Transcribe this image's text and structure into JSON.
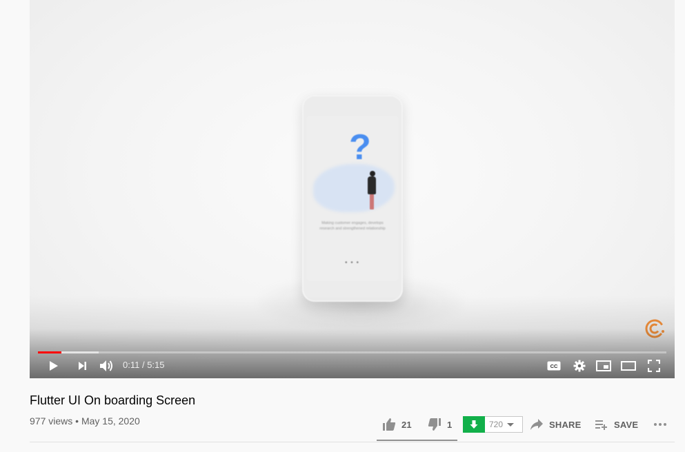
{
  "player": {
    "current_time": "0:11",
    "separator": " / ",
    "duration": "5:15",
    "played_fraction": 0.037,
    "loaded_fraction": 0.097,
    "video_tagline": "Making customer engages, develops research and strengthened relationship"
  },
  "video": {
    "title": "Flutter UI On boarding Screen",
    "views": "977 views",
    "dot": " • ",
    "date": "May 15, 2020"
  },
  "actions": {
    "likes": "21",
    "dislikes": "1",
    "download_count": "720",
    "share_label": "SHARE",
    "save_label": "SAVE"
  },
  "colors": {
    "progress_played": "#ff0000",
    "download_green": "#12b04a",
    "logo_orange": "#f2913d",
    "qmark_blue": "#4a8ef0"
  },
  "icons": [
    "play-icon",
    "next-icon",
    "volume-icon",
    "captions-icon",
    "settings-icon",
    "miniplayer-icon",
    "theater-icon",
    "fullscreen-icon",
    "like-icon",
    "dislike-icon",
    "download-icon",
    "share-icon",
    "save-playlist-icon",
    "more-icon",
    "channel-logo-icon"
  ]
}
